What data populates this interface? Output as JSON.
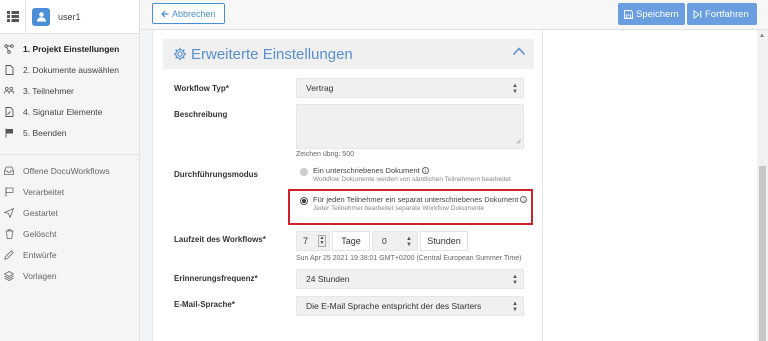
{
  "user": {
    "name": "user1"
  },
  "steps": [
    {
      "label": "1. Projekt Einstellungen",
      "icon": "flow-icon",
      "active": true
    },
    {
      "label": "2. Dokumente auswählen",
      "icon": "document-icon",
      "active": false
    },
    {
      "label": "3. Teilnehmer",
      "icon": "people-icon",
      "active": false
    },
    {
      "label": "4. Signatur Elemente",
      "icon": "signature-doc-icon",
      "active": false
    },
    {
      "label": "5. Beenden",
      "icon": "flag-icon",
      "active": false
    }
  ],
  "nav": [
    {
      "label": "Offene DocuWorkflows",
      "icon": "inbox-icon"
    },
    {
      "label": "Verarbeitet",
      "icon": "flag-icon"
    },
    {
      "label": "Gestartet",
      "icon": "send-icon"
    },
    {
      "label": "Gelöscht",
      "icon": "trash-icon"
    },
    {
      "label": "Entwürfe",
      "icon": "pencil-icon"
    },
    {
      "label": "Vorlagen",
      "icon": "stack-icon"
    }
  ],
  "toolbar": {
    "cancel_label": "Abbrechen",
    "save_label": "Speichern",
    "next_label": "Fortfahren"
  },
  "section": {
    "title": "Erweiterte Einstellungen"
  },
  "form": {
    "workflow_type": {
      "label": "Workflow Typ*",
      "value": "Vertrag"
    },
    "description": {
      "label": "Beschreibung",
      "hint": "Zeichen übrig: 500"
    },
    "mode": {
      "label": "Durchführungsmodus",
      "option1": {
        "text": "Ein unterschriebenes Dokument",
        "sub": "Workflow Dokumente werden von sämtlichen Teilnehmern bearbeitet"
      },
      "option2": {
        "text": "Für jeden Teilnehmer ein separat unterschriebenes Dokument",
        "sub": "Jeder Teilnehmer bearbeitet separate Workflow Dokumente"
      }
    },
    "duration": {
      "label": "Laufzeit des Workflows*",
      "days_value": "7",
      "days_unit": "Tage",
      "hours_value": "0",
      "hours_unit": "Stunden",
      "end_date": "Sun Apr 25 2021 19:38:01 GMT+0200 (Central European Summer Time)"
    },
    "reminder": {
      "label": "Erinnerungsfrequenz*",
      "value": "24 Stunden"
    },
    "email_language": {
      "label": "E-Mail-Sprache*",
      "value": "Die E-Mail Sprache entspricht der des Starters"
    }
  },
  "colors": {
    "accent": "#4a8fd6",
    "highlight": "#d0202c"
  }
}
